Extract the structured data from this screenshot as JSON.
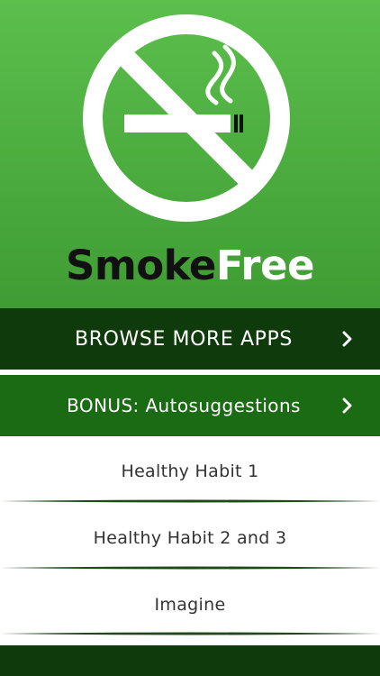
{
  "header": {
    "brand_part1": "Smoke",
    "brand_part2": "Free",
    "logo_icon": "no-smoking-icon"
  },
  "menu": {
    "primary": [
      {
        "label": "BROWSE MORE APPS",
        "icon": "chevron-right-icon"
      },
      {
        "label": "BONUS: Autosuggestions",
        "icon": "chevron-right-icon"
      }
    ],
    "items": [
      {
        "label": "Healthy Habit 1"
      },
      {
        "label": "Healthy Habit 2 and 3"
      },
      {
        "label": "Imagine"
      }
    ]
  },
  "colors": {
    "hero_green": "#4caf3f",
    "browse_bg": "#0f3a0c",
    "bonus_bg": "#1b6a14",
    "text_dark": "#333333"
  }
}
